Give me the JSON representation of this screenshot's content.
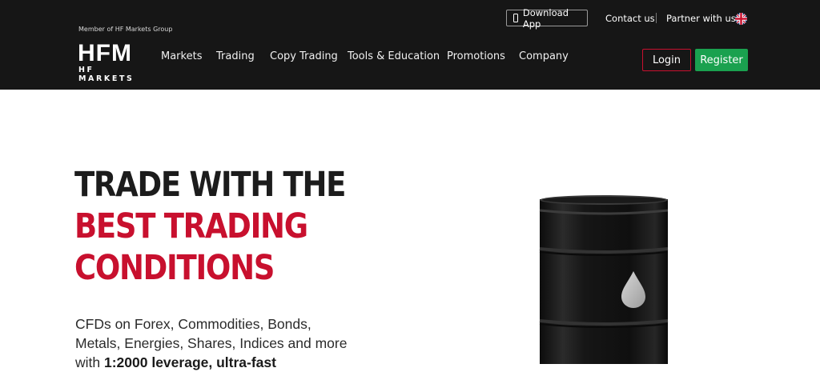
{
  "header": {
    "member_text": "Member of HF Markets Group",
    "logo": {
      "main": "HFM",
      "sub": "HF MARKETS"
    },
    "nav": [
      "Markets",
      "Trading",
      "Copy Trading",
      "Tools & Education",
      "Promotions",
      "Company"
    ],
    "download_app": "Download App",
    "contact": "Contact us",
    "partner": "Partner with us",
    "language_icon": "uk-flag-icon",
    "login": "Login",
    "register": "Register"
  },
  "hero": {
    "line1": "TRADE WITH THE",
    "line2": "BEST TRADING",
    "line3": "CONDITIONS",
    "desc_line1": "CFDs on Forex, Commodities, Bonds,",
    "desc_line2": "Metals, Energies, Shares, Indices and more",
    "desc_line3_prefix": "with ",
    "desc_line3_bold": "1:2000 leverage, ultra-fast"
  },
  "colors": {
    "header_bg": "#161616",
    "accent_red": "#c8102e",
    "register_green": "#1aa14f"
  }
}
